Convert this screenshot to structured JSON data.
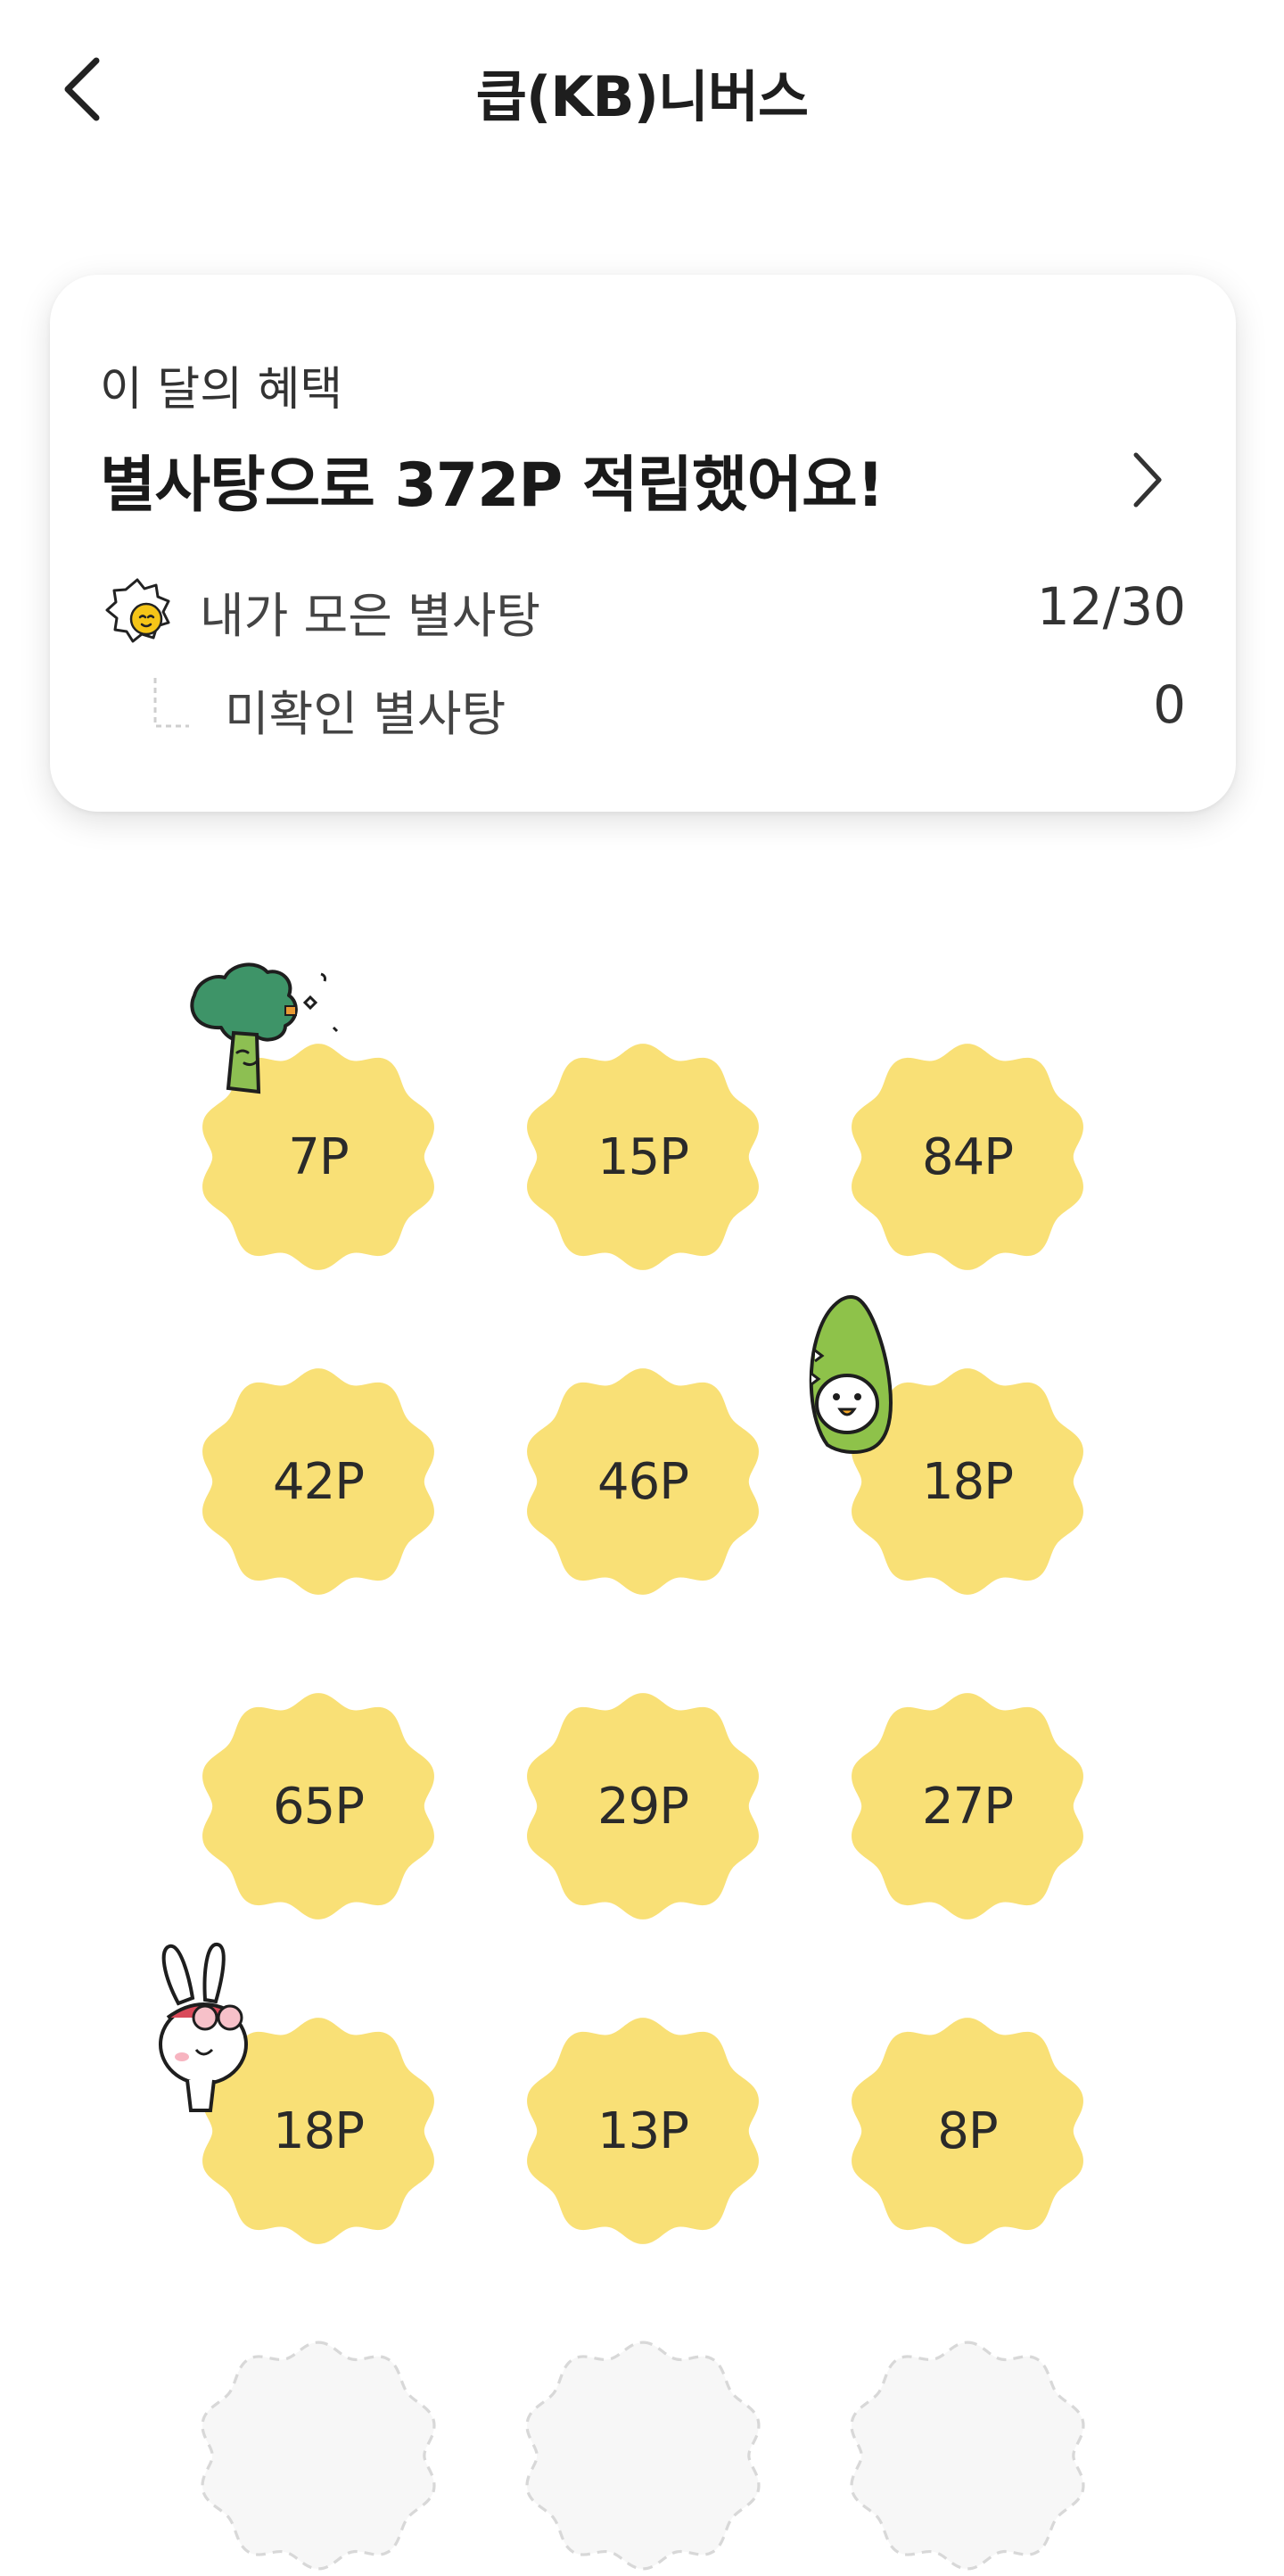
{
  "header": {
    "title": "큽(KB)니버스",
    "back_icon": "chevron-left-icon"
  },
  "summary": {
    "subtitle": "이 달의 혜택",
    "headline": "별사탕으로 372P 적립했어요!",
    "collected_label": "내가 모은 별사탕",
    "collected_value": "12/30",
    "unchecked_label": "미확인 별사탕",
    "unchecked_value": "0"
  },
  "candies": [
    {
      "points": "7P"
    },
    {
      "points": "15P"
    },
    {
      "points": "84P"
    },
    {
      "points": "42P"
    },
    {
      "points": "46P"
    },
    {
      "points": "18P"
    },
    {
      "points": "65P"
    },
    {
      "points": "29P"
    },
    {
      "points": "27P"
    },
    {
      "points": "18P"
    },
    {
      "points": "13P"
    },
    {
      "points": "8P"
    }
  ],
  "colors": {
    "candy_fill": "#F9E076",
    "candy_placeholder_stroke": "#D8D8D8",
    "accent": "#F5C518"
  }
}
